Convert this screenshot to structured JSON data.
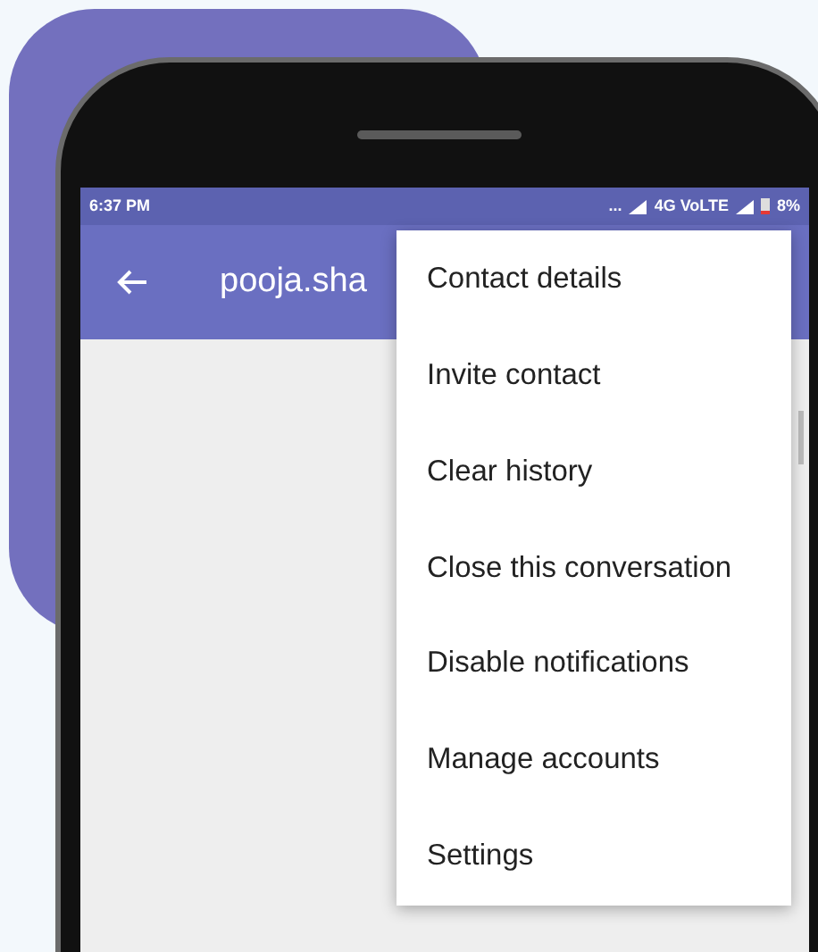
{
  "status_bar": {
    "time": "6:37 PM",
    "more": "...",
    "network": "4G VoLTE",
    "battery": "8%"
  },
  "app_bar": {
    "title": "pooja.sha"
  },
  "menu": {
    "items": [
      {
        "label": "Contact details"
      },
      {
        "label": "Invite contact"
      },
      {
        "label": "Clear history"
      },
      {
        "label": "Close this conversation"
      },
      {
        "label": "Disable notifications"
      },
      {
        "label": "Manage accounts"
      },
      {
        "label": "Settings"
      }
    ]
  }
}
